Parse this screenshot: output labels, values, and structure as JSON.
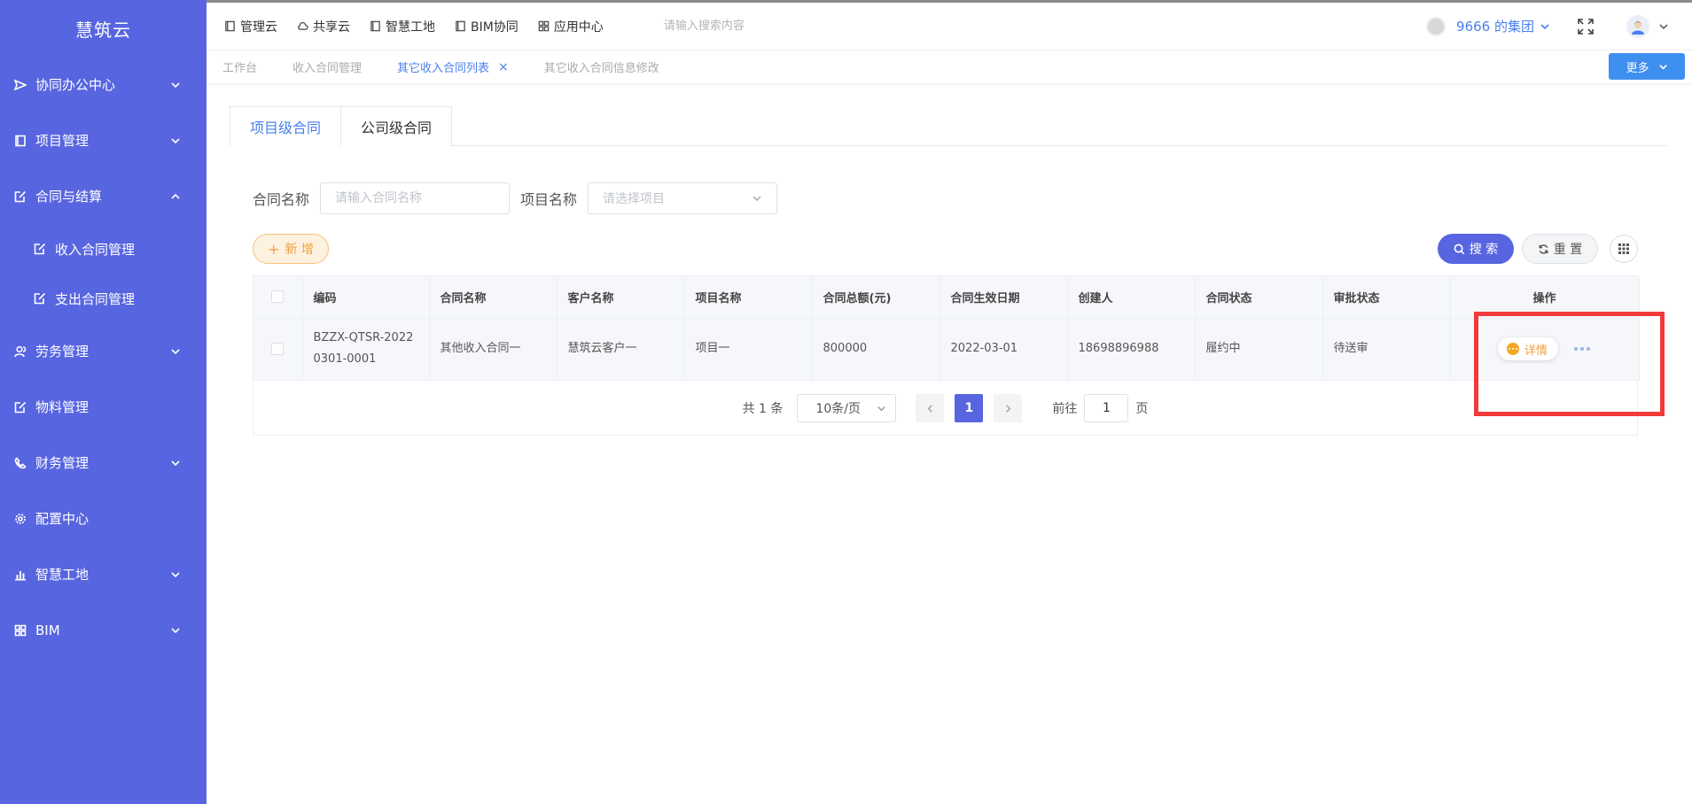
{
  "sidebar": {
    "logo": "慧筑云",
    "items": [
      {
        "label": "协同办公中心",
        "icon": "send-icon"
      },
      {
        "label": "项目管理",
        "icon": "book-icon"
      },
      {
        "label": "合同与结算",
        "icon": "edit-doc-icon"
      },
      {
        "label": "收入合同管理",
        "icon": "edit-doc-icon"
      },
      {
        "label": "支出合同管理",
        "icon": "edit-doc-icon"
      },
      {
        "label": "劳务管理",
        "icon": "users-icon"
      },
      {
        "label": "物料管理",
        "icon": "edit-doc-icon"
      },
      {
        "label": "财务管理",
        "icon": "phone-icon"
      },
      {
        "label": "配置中心",
        "icon": "gear-icon"
      },
      {
        "label": "智慧工地",
        "icon": "bar-chart-icon"
      },
      {
        "label": "BIM",
        "icon": "grid-icon"
      }
    ]
  },
  "topbar": {
    "nav": [
      {
        "label": "管理云",
        "icon": "book-icon"
      },
      {
        "label": "共享云",
        "icon": "cloud-icon"
      },
      {
        "label": "智慧工地",
        "icon": "book-icon"
      },
      {
        "label": "BIM协同",
        "icon": "book-icon"
      },
      {
        "label": "应用中心",
        "icon": "grid-icon"
      }
    ],
    "search_placeholder": "请输入搜索内容",
    "org_name": "9666 的集团"
  },
  "tabs": [
    {
      "label": "工作台"
    },
    {
      "label": "收入合同管理"
    },
    {
      "label": "其它收入合同列表",
      "close": "×"
    },
    {
      "label": "其它收入合同信息修改"
    }
  ],
  "more_label": "更多",
  "level_tabs": [
    "项目级合同",
    "公司级合同"
  ],
  "filters": {
    "contract_name_label": "合同名称",
    "contract_name_placeholder": "请输入合同名称",
    "project_name_label": "项目名称",
    "project_name_placeholder": "请选择项目"
  },
  "buttons": {
    "add": "新 增",
    "add_plus": "+",
    "search": "搜 索",
    "reset": "重 置"
  },
  "table": {
    "headers": [
      "编码",
      "合同名称",
      "客户名称",
      "项目名称",
      "合同总额(元)",
      "合同生效日期",
      "创建人",
      "合同状态",
      "审批状态",
      "操作"
    ],
    "rows": [
      {
        "code": "BZZX-QTSR-20220301-0001",
        "contract_name": "其他收入合同一",
        "customer": "慧筑云客户一",
        "project": "项目一",
        "amount": "800000",
        "date": "2022-03-01",
        "creator": "18698896988",
        "contract_status": "履约中",
        "approval_status": "待送审",
        "detail_label": "详情"
      }
    ]
  },
  "pagination": {
    "total": "共 1 条",
    "page_size": "10条/页",
    "current": "1",
    "goto_label": "前往",
    "goto_value": "1",
    "page_suffix": "页"
  },
  "colors": {
    "sidebar": "#5865e0",
    "accent": "#4a7ff0",
    "highlight": "#f23a3a",
    "warning": "#f0a040"
  }
}
